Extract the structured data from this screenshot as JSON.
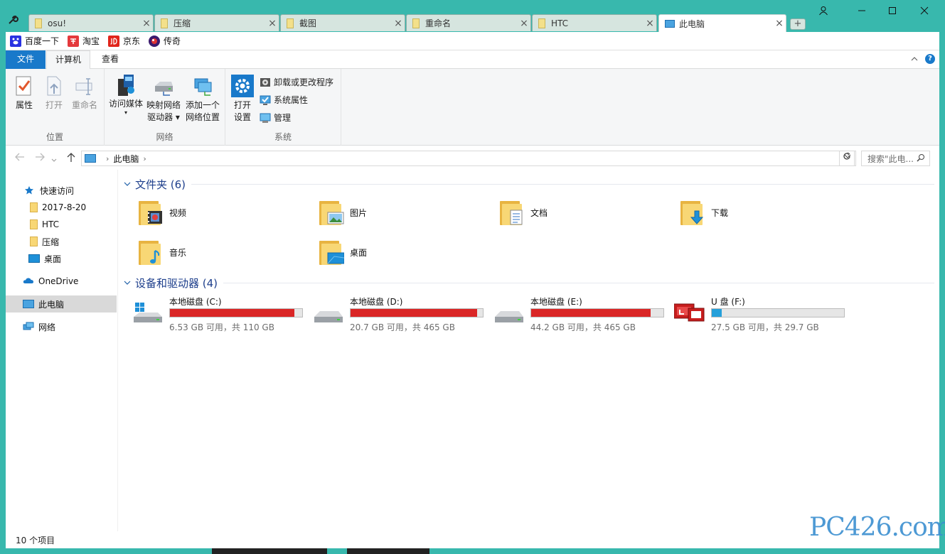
{
  "browser": {
    "tabs": [
      {
        "label": "osu!",
        "icon": "folder-doc-icon"
      },
      {
        "label": "压缩",
        "icon": "folder-doc-icon"
      },
      {
        "label": "截图",
        "icon": "folder-doc-icon"
      },
      {
        "label": "重命名",
        "icon": "folder-doc-icon"
      },
      {
        "label": "HTC",
        "icon": "folder-doc-icon"
      },
      {
        "label": "此电脑",
        "icon": "computer-icon",
        "active": true
      }
    ],
    "new_tab": "+",
    "close_glyph": "×",
    "bookmarks": [
      {
        "label": "百度一下",
        "icon": "baidu-icon",
        "color": "#2932e1"
      },
      {
        "label": "淘宝",
        "icon": "taobao-icon",
        "color": "#e4393c"
      },
      {
        "label": "京东",
        "icon": "jd-icon",
        "color": "#e1251b"
      },
      {
        "label": "传奇",
        "icon": "legend-game-icon",
        "color": "#7a1d1d"
      }
    ]
  },
  "ribbon": {
    "tabs": {
      "file": "文件",
      "computer": "计算机",
      "view": "查看"
    },
    "groups": {
      "location": {
        "name": "位置",
        "buttons": {
          "properties": "属性",
          "open": "打开",
          "rename": "重命名"
        }
      },
      "network": {
        "name": "网络",
        "buttons": {
          "media": "访问媒体",
          "map_drive_1": "映射网络",
          "map_drive_2": "驱动器",
          "add_loc_1": "添加一个",
          "add_loc_2": "网络位置"
        }
      },
      "system": {
        "name": "系统",
        "open_settings_1": "打开",
        "open_settings_2": "设置",
        "uninstall": "卸载或更改程序",
        "sys_props": "系统属性",
        "manage": "管理"
      }
    }
  },
  "address": {
    "crumb": "此电脑",
    "search_placeholder": "搜索\"此电..."
  },
  "nav": {
    "quick_access": "快速访问",
    "pinned": [
      "2017-8-20",
      "HTC",
      "压缩",
      "桌面"
    ],
    "onedrive": "OneDrive",
    "this_pc": "此电脑",
    "network": "网络"
  },
  "content": {
    "folders_header": "文件夹 (6)",
    "folders": [
      {
        "name": "视频",
        "overlay": "video-film-icon"
      },
      {
        "name": "图片",
        "overlay": "picture-icon"
      },
      {
        "name": "文档",
        "overlay": "document-icon"
      },
      {
        "name": "下载",
        "overlay": "download-arrow-icon"
      },
      {
        "name": "音乐",
        "overlay": "music-note-icon"
      },
      {
        "name": "桌面",
        "overlay": "desktop-icon"
      }
    ],
    "drives_header": "设备和驱动器 (4)",
    "drives": [
      {
        "name": "本地磁盘 (C:)",
        "info": "6.53 GB 可用，共 110 GB",
        "used_fraction": 0.94,
        "color": "#da2626"
      },
      {
        "name": "本地磁盘 (D:)",
        "info": "20.7 GB 可用，共 465 GB",
        "used_fraction": 0.955,
        "color": "#da2626"
      },
      {
        "name": "本地磁盘 (E:)",
        "info": "44.2 GB 可用，共 465 GB",
        "used_fraction": 0.905,
        "color": "#da2626"
      },
      {
        "name": "U 盘 (F:)",
        "info": "27.5 GB 可用，共 29.7 GB",
        "used_fraction": 0.074,
        "color": "#26a0da"
      }
    ]
  },
  "status": {
    "count": "10 个项目"
  },
  "watermark": "PC426.com"
}
